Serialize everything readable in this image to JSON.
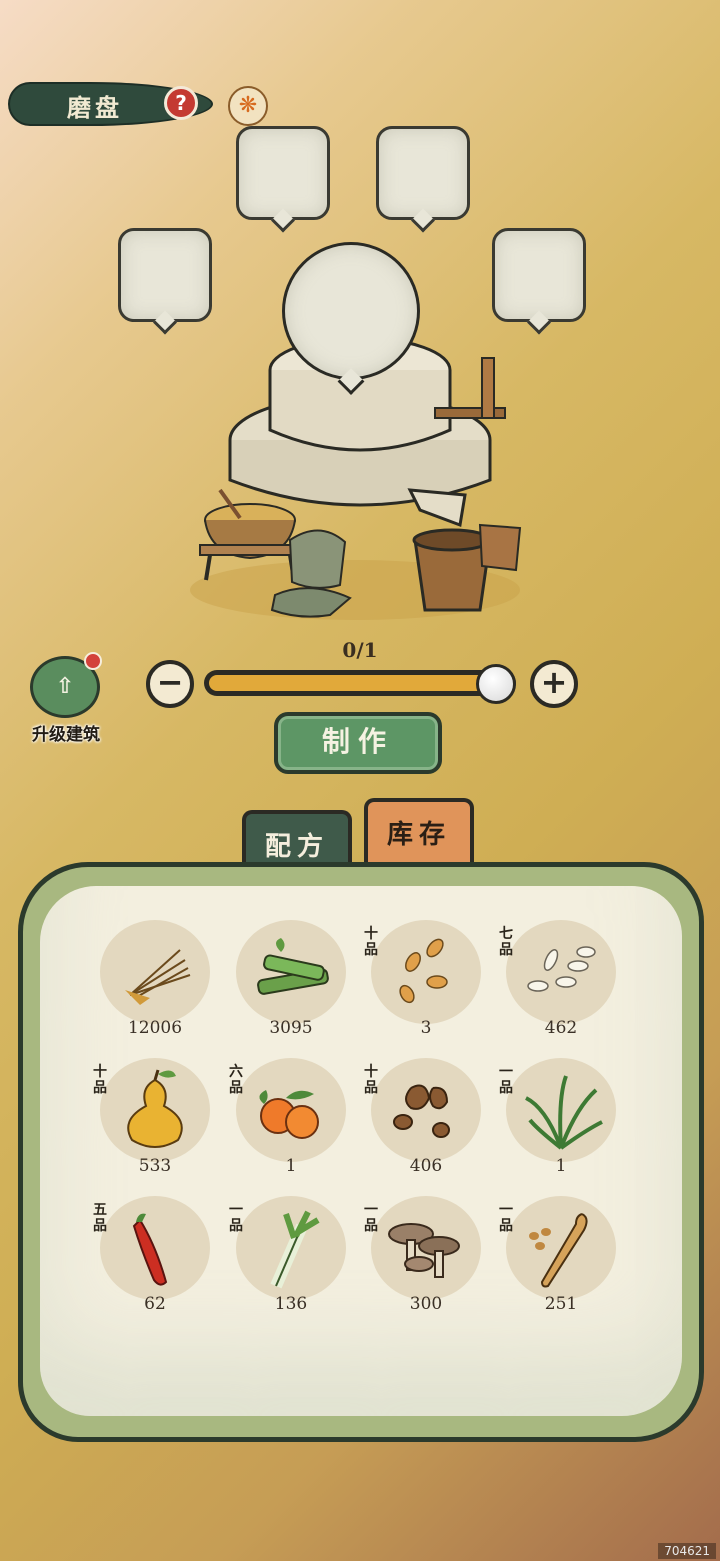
{
  "header": {
    "title": "磨盘",
    "help_glyph": "?",
    "help_icon": "help-icon",
    "phoenix_icon": "phoenix-icon"
  },
  "production": {
    "count": "0/1",
    "slider_fraction": 1.0
  },
  "controls": {
    "minus_glyph": "−",
    "plus_glyph": "+",
    "upgrade_label": "升级建筑",
    "upgrade_glyph": "⇧",
    "craft_label": "制作"
  },
  "tabs": [
    {
      "label": "配方",
      "active": false
    },
    {
      "label": "库存",
      "active": true
    }
  ],
  "inventory": [
    {
      "icon": "straw-icon",
      "grade": "",
      "count": "12006"
    },
    {
      "icon": "bamboo-icon",
      "grade": "",
      "count": "3095"
    },
    {
      "icon": "seeds-icon",
      "grade": "十品",
      "count": "3"
    },
    {
      "icon": "rice-icon",
      "grade": "七品",
      "count": "462"
    },
    {
      "icon": "pear-icon",
      "grade": "十品",
      "count": "533"
    },
    {
      "icon": "orange-icon",
      "grade": "六品",
      "count": "1"
    },
    {
      "icon": "nuts-icon",
      "grade": "十品",
      "count": "406"
    },
    {
      "icon": "grass-icon",
      "grade": "一品",
      "count": "1"
    },
    {
      "icon": "chili-icon",
      "grade": "五品",
      "count": "62"
    },
    {
      "icon": "scallion-icon",
      "grade": "一品",
      "count": "136"
    },
    {
      "icon": "mushroom-icon",
      "grade": "一品",
      "count": "300"
    },
    {
      "icon": "root-icon",
      "grade": "一品",
      "count": "251"
    }
  ],
  "watermark": "704621",
  "colors": {
    "accent_green": "#5d9665",
    "tab_active": "#e0945a",
    "badge_red": "#d3423b"
  }
}
